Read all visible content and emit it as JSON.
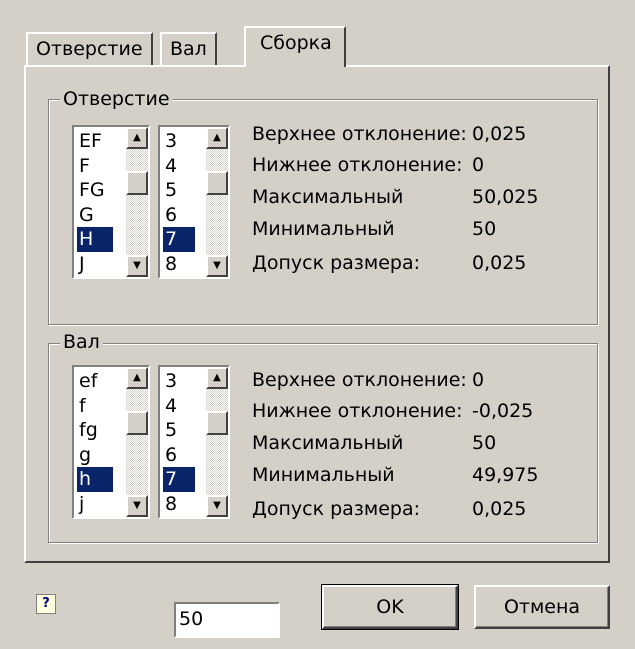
{
  "tabs": [
    "Отверстие",
    "Вал",
    "Сборка"
  ],
  "active_tab": "Сборка",
  "hole_group": {
    "title": "Отверстие",
    "letters": [
      "EF",
      "F",
      "FG",
      "G",
      "H",
      "J"
    ],
    "letters_selected": "H",
    "grades": [
      "3",
      "4",
      "5",
      "6",
      "7",
      "8"
    ],
    "grades_selected": "7",
    "info": [
      {
        "label": "Верхнее отклонение:",
        "value": "0,025"
      },
      {
        "label": "Нижнее отклонение:",
        "value": "0"
      },
      {
        "label": "Максимальный",
        "value": "50,025"
      },
      {
        "label": "Минимальный",
        "value": "50"
      },
      {
        "label": "Допуск размера:",
        "value": "0,025"
      }
    ]
  },
  "shaft_group": {
    "title": "Вал",
    "letters": [
      "ef",
      "f",
      "fg",
      "g",
      "h",
      "j"
    ],
    "letters_selected": "h",
    "grades": [
      "3",
      "4",
      "5",
      "6",
      "7",
      "8"
    ],
    "grades_selected": "7",
    "info": [
      {
        "label": "Верхнее отклонение:",
        "value": "0"
      },
      {
        "label": "Нижнее отклонение:",
        "value": "-0,025"
      },
      {
        "label": "Максимальный",
        "value": "50"
      },
      {
        "label": "Минимальный",
        "value": "49,975"
      },
      {
        "label": "Допуск размера:",
        "value": "0,025"
      }
    ]
  },
  "footer": {
    "help_icon_text": "?",
    "size_value": "50",
    "ok_label": "OK",
    "cancel_label": "Отмена"
  }
}
